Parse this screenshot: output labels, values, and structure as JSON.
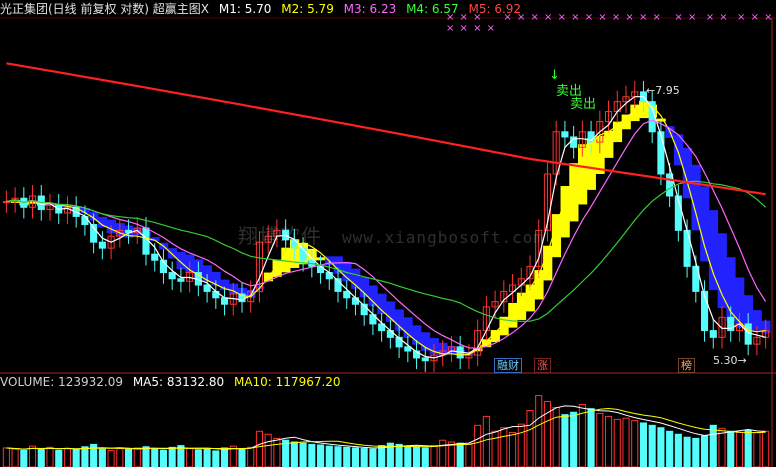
{
  "header": {
    "title": "光正集团(日线 前复权 对数) 超赢主图X",
    "ma": [
      {
        "key": "M1",
        "text": "M1: 5.70"
      },
      {
        "key": "M2",
        "text": "M2: 5.79"
      },
      {
        "key": "M3",
        "text": "M3: 6.23"
      },
      {
        "key": "M4",
        "text": "M4: 6.57"
      },
      {
        "key": "M5",
        "text": "M5: 6.92"
      }
    ]
  },
  "volume_header": {
    "title": "VOLUME: 123932.09",
    "ma5": "MA5: 83132.80",
    "ma10": "MA10: 117967.20"
  },
  "annotations": {
    "sell_1": "卖出",
    "sell_2": "卖出",
    "peak": "7.95",
    "low": "5.30",
    "tag_1": "融财",
    "tag_2": "涨",
    "tag_3": "榜",
    "watermark_cn": "翔博软件",
    "watermark_url": "www.xiangbosoft.com"
  },
  "colors": {
    "up": "#ff3232",
    "down": "#54fcfc",
    "ma1": "#ffffff",
    "ma2": "#ffff00",
    "ma3": "#ff66ff",
    "ma4": "#33cc33",
    "ma5": "#ff2020",
    "band_up": "#ffff00",
    "band_dn": "#2222ff"
  },
  "chart_data": {
    "type": "candlestick",
    "price_range": [
      5.2,
      8.4
    ],
    "close": [
      6.55,
      6.58,
      6.5,
      6.6,
      6.48,
      6.52,
      6.45,
      6.5,
      6.42,
      6.35,
      6.2,
      6.15,
      6.25,
      6.3,
      6.28,
      6.32,
      6.1,
      6.05,
      5.95,
      5.9,
      5.88,
      5.95,
      5.85,
      5.8,
      5.75,
      5.7,
      5.78,
      5.72,
      5.8,
      6.2,
      6.25,
      6.3,
      6.22,
      6.15,
      6.05,
      6.0,
      5.95,
      5.9,
      5.8,
      5.75,
      5.7,
      5.62,
      5.55,
      5.5,
      5.45,
      5.38,
      5.35,
      5.3,
      5.28,
      5.32,
      5.35,
      5.38,
      5.3,
      5.32,
      5.5,
      5.68,
      5.72,
      5.8,
      5.85,
      5.9,
      6.0,
      6.3,
      6.8,
      7.2,
      7.15,
      7.05,
      7.2,
      7.1,
      7.3,
      7.4,
      7.5,
      7.55,
      7.6,
      7.5,
      7.2,
      6.8,
      6.6,
      6.3,
      6.0,
      5.8,
      5.5,
      5.45,
      5.6,
      5.5,
      5.55,
      5.4,
      5.45,
      5.5
    ],
    "volume": [
      32,
      30,
      28,
      35,
      30,
      33,
      28,
      31,
      29,
      34,
      38,
      30,
      28,
      31,
      30,
      32,
      34,
      30,
      28,
      33,
      36,
      31,
      29,
      30,
      27,
      32,
      35,
      30,
      33,
      60,
      55,
      48,
      45,
      42,
      40,
      38,
      37,
      35,
      34,
      33,
      32,
      31,
      30,
      36,
      40,
      38,
      35,
      34,
      32,
      36,
      45,
      42,
      40,
      38,
      70,
      85,
      60,
      66,
      58,
      72,
      95,
      120,
      110,
      100,
      88,
      92,
      105,
      98,
      90,
      85,
      80,
      82,
      78,
      74,
      70,
      66,
      60,
      55,
      50,
      48,
      52,
      70,
      65,
      60,
      58,
      62,
      58,
      60
    ]
  }
}
